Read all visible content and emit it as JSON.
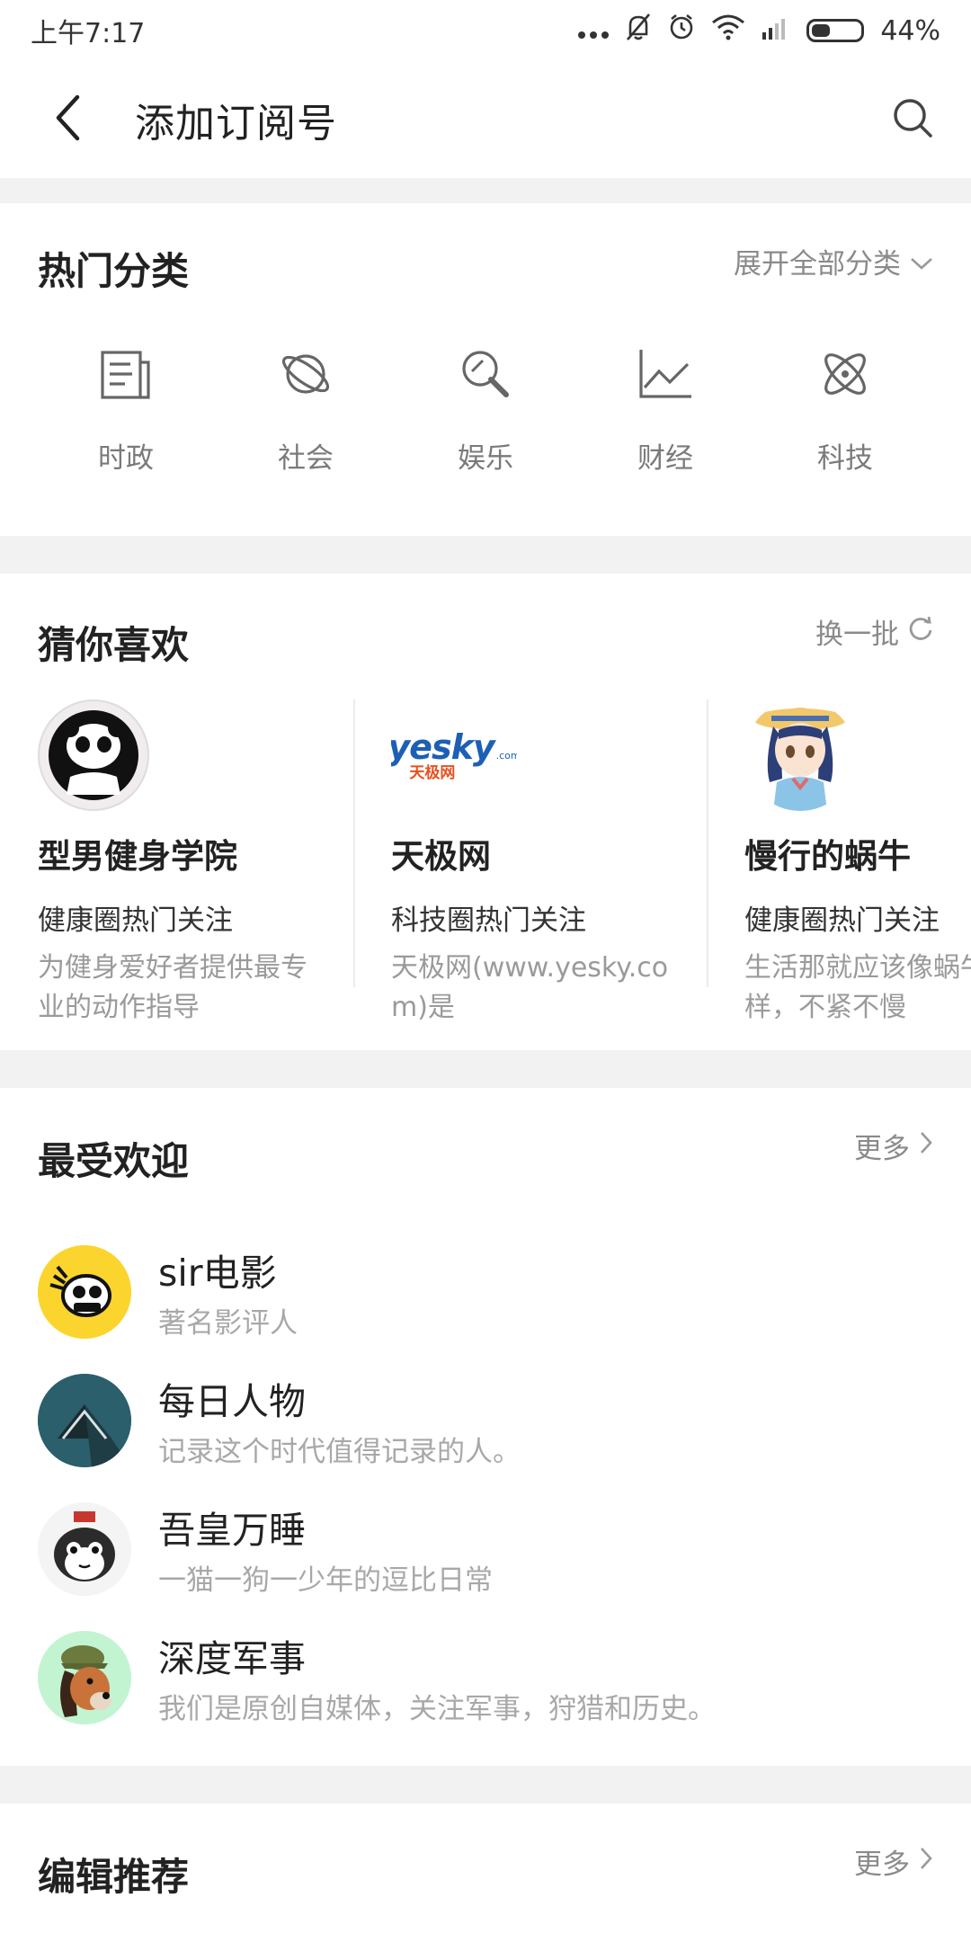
{
  "status": {
    "time": "上午7:17",
    "battery": "44%",
    "battery_level": 0.44
  },
  "appbar": {
    "title": "添加订阅号",
    "back_icon": "back-arrow-icon",
    "search_icon": "search-icon"
  },
  "hot": {
    "title": "热门分类",
    "expand_label": "展开全部分类",
    "categories": [
      {
        "label": "时政",
        "icon": "newspaper-icon"
      },
      {
        "label": "社会",
        "icon": "planet-icon"
      },
      {
        "label": "娱乐",
        "icon": "magnifier-icon"
      },
      {
        "label": "财经",
        "icon": "line-chart-icon"
      },
      {
        "label": "科技",
        "icon": "atom-icon"
      }
    ]
  },
  "guess": {
    "title": "猜你喜欢",
    "refresh_label": "换一批",
    "items": [
      {
        "name": "型男健身学院",
        "tag": "健康圈热门关注",
        "desc": "为健身爱好者提供最专业的动作指导"
      },
      {
        "name": "天极网",
        "tag": "科技圈热门关注",
        "desc": "天极网(www.yesky.com)是",
        "logo_text": "yesky",
        "logo_sub": "天极网",
        "logo_com": ".com"
      },
      {
        "name": "慢行的蜗牛",
        "tag": "健康圈热门关注",
        "desc": "生活那就应该像蜗牛一样，不紧不慢"
      }
    ]
  },
  "popular": {
    "title": "最受欢迎",
    "more_label": "更多",
    "items": [
      {
        "name": "sir电影",
        "desc": "著名影评人"
      },
      {
        "name": "每日人物",
        "desc": "记录这个时代值得记录的人。"
      },
      {
        "name": "吾皇万睡",
        "desc": "一猫一狗一少年的逗比日常"
      },
      {
        "name": "深度军事",
        "desc": "我们是原创自媒体，关注军事，狩猎和历史。"
      }
    ]
  },
  "editor": {
    "title": "编辑推荐",
    "more_label": "更多"
  }
}
